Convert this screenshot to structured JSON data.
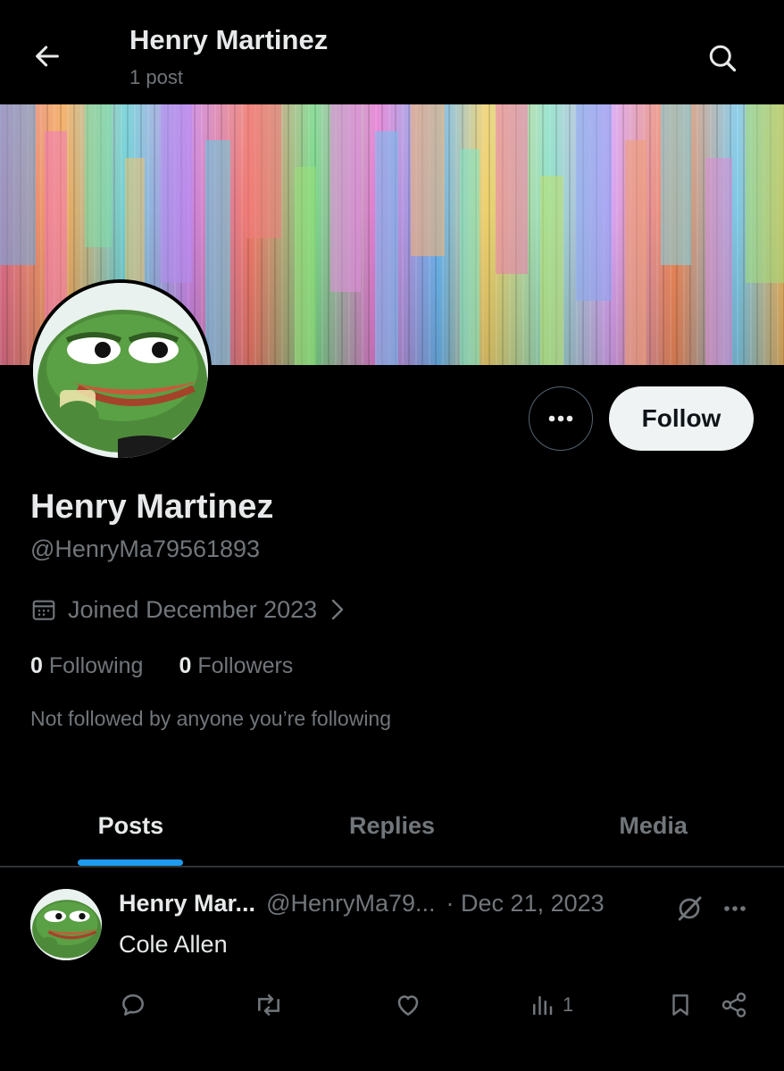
{
  "header": {
    "title": "Henry Martinez",
    "subtitle": "1 post",
    "back_icon": "arrow-left-icon",
    "search_icon": "search-icon"
  },
  "banner": {
    "description_icon": "colorful-glitch-banner"
  },
  "profile": {
    "name": "Henry Martinez",
    "handle": "@HenryMa79561893",
    "joined": "Joined December 2023",
    "following_count": "0",
    "following_label": "Following",
    "followers_count": "0",
    "followers_label": "Followers",
    "not_followed": "Not followed by anyone you’re following"
  },
  "actions": {
    "follow_label": "Follow",
    "more_icon": "more-horizontal-icon"
  },
  "tabs": [
    {
      "label": "Posts",
      "active": true
    },
    {
      "label": "Replies",
      "active": false
    },
    {
      "label": "Media",
      "active": false
    }
  ],
  "post": {
    "author": "Henry Mar...",
    "handle": "@HenryMa79...",
    "date": "· Dec 21, 2023",
    "text": "Cole Allen",
    "views": "1"
  },
  "colors": {
    "background": "#000000",
    "accent": "#1d9bf0",
    "text": "#e7e9ea",
    "muted": "#71767b"
  }
}
